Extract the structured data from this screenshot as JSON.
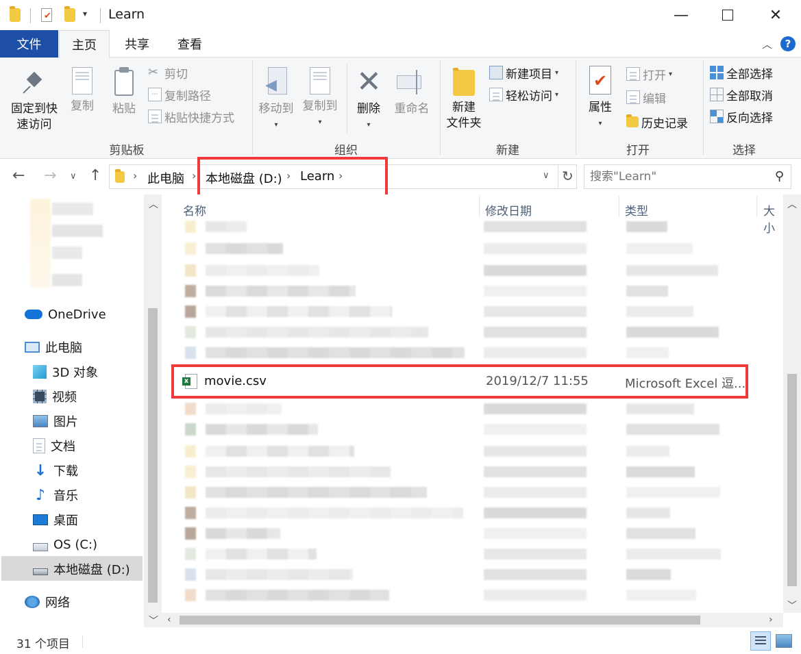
{
  "window": {
    "title": "Learn"
  },
  "tabs": {
    "file": "文件",
    "home": "主页",
    "share": "共享",
    "view": "查看"
  },
  "ribbon": {
    "clipboard": {
      "label": "剪贴板",
      "pin_line1": "固定到快",
      "pin_line2": "速访问",
      "copy": "复制",
      "paste": "粘贴",
      "cut": "剪切",
      "copy_path": "复制路径",
      "paste_shortcut": "粘贴快捷方式"
    },
    "organize": {
      "label": "组织",
      "move_to": "移动到",
      "copy_to": "复制到",
      "delete": "删除",
      "rename": "重命名"
    },
    "new": {
      "label": "新建",
      "new_folder_line1": "新建",
      "new_folder_line2": "文件夹",
      "new_item": "新建项目",
      "easy_access": "轻松访问"
    },
    "open": {
      "label": "打开",
      "properties": "属性",
      "open": "打开",
      "edit": "编辑",
      "history": "历史记录"
    },
    "select": {
      "label": "选择",
      "select_all": "全部选择",
      "select_none": "全部取消",
      "invert": "反向选择"
    }
  },
  "address": {
    "crumbs": [
      "此电脑",
      "本地磁盘 (D:)",
      "Learn"
    ],
    "search_placeholder": "搜索\"Learn\""
  },
  "navpane": {
    "items": [
      "OneDrive",
      "此电脑",
      "3D 对象",
      "视频",
      "图片",
      "文档",
      "下载",
      "音乐",
      "桌面",
      "OS (C:)",
      "本地磁盘 (D:)",
      "网络"
    ]
  },
  "columns": {
    "name": "名称",
    "modified": "修改日期",
    "type": "类型",
    "size": "大小"
  },
  "highlighted_file": {
    "name": "movie.csv",
    "modified": "2019/12/7 11:55",
    "type": "Microsoft Excel 逗..."
  },
  "status": {
    "count": "31 个项目"
  },
  "colors": {
    "accent": "#1e4fa6",
    "highlight_box": "#ef3b3b",
    "folder": "#f3c843"
  }
}
